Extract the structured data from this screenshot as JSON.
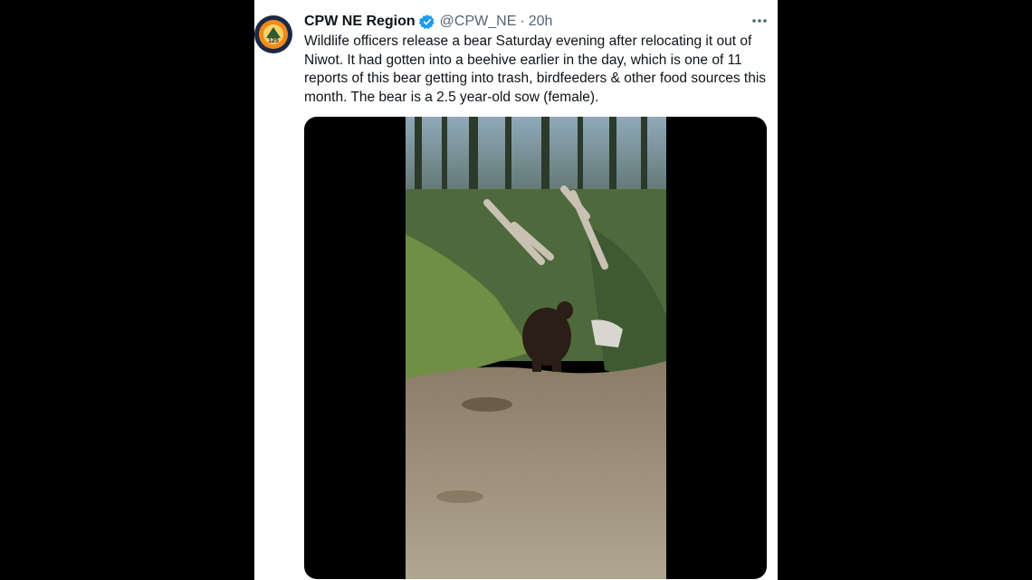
{
  "tweet": {
    "author_name": "CPW NE Region",
    "handle": "@CPW_NE",
    "separator": "·",
    "time": "20h",
    "text": "Wildlife officers release a bear Saturday evening after relocating it out of Niwot. It had gotten into a beehive earlier in the day, which is one of 11 reports of this bear getting into trash, birdfeeders & other food sources this month. The bear is a 2.5 year-old sow (female).",
    "verified_icon": "verified-badge-icon",
    "more_icon": "more-options-icon",
    "avatar_icon": "cpw-logo-icon"
  },
  "colors": {
    "verified": "#1d9bf0",
    "secondary_text": "#536471",
    "primary_text": "#0f1419",
    "background": "#ffffff"
  }
}
